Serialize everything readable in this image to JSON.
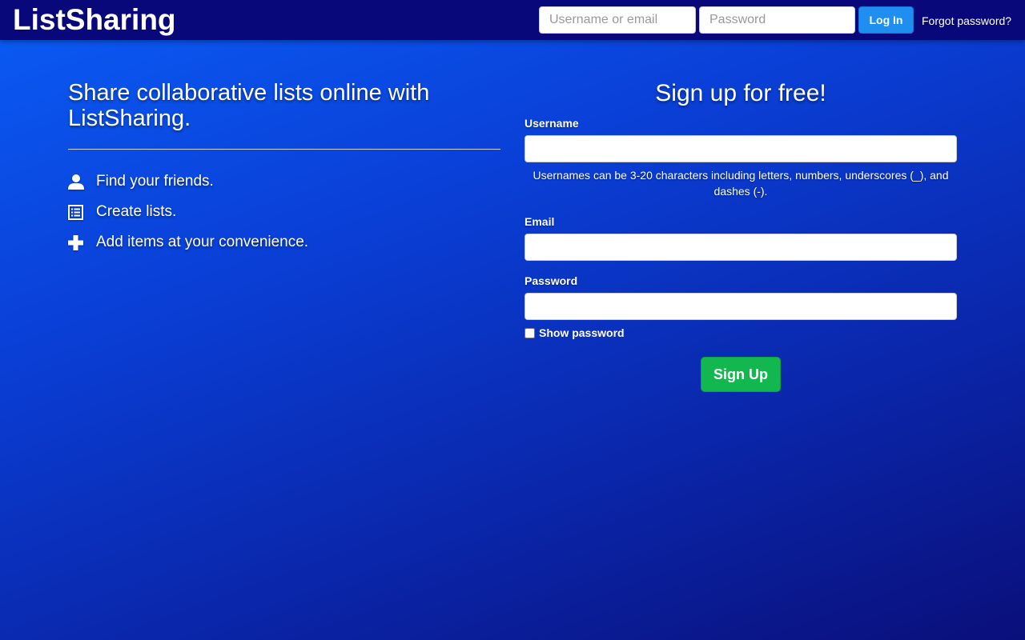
{
  "navbar": {
    "brand": "ListSharing",
    "username_placeholder": "Username or email",
    "password_placeholder": "Password",
    "login_label": "Log In",
    "forgot_label": "Forgot password?"
  },
  "hero": {
    "title": "Share collaborative lists online with ListSharing.",
    "features": [
      {
        "icon": "user-icon",
        "label": "Find your friends."
      },
      {
        "icon": "list-icon",
        "label": "Create lists."
      },
      {
        "icon": "plus-icon",
        "label": "Add items at your convenience."
      }
    ]
  },
  "signup": {
    "title": "Sign up for free!",
    "username_label": "Username",
    "username_help": "Usernames can be 3-20 characters including letters, numbers, underscores (_), and dashes (-).",
    "email_label": "Email",
    "password_label": "Password",
    "show_password_label": "Show password",
    "submit_label": "Sign Up"
  },
  "colors": {
    "navbar_bg": "#08087a",
    "login_button": "#1e8ff0",
    "signup_button": "#12b84f",
    "background_start": "#0a5cf5",
    "background_end": "#0a0f7a"
  }
}
